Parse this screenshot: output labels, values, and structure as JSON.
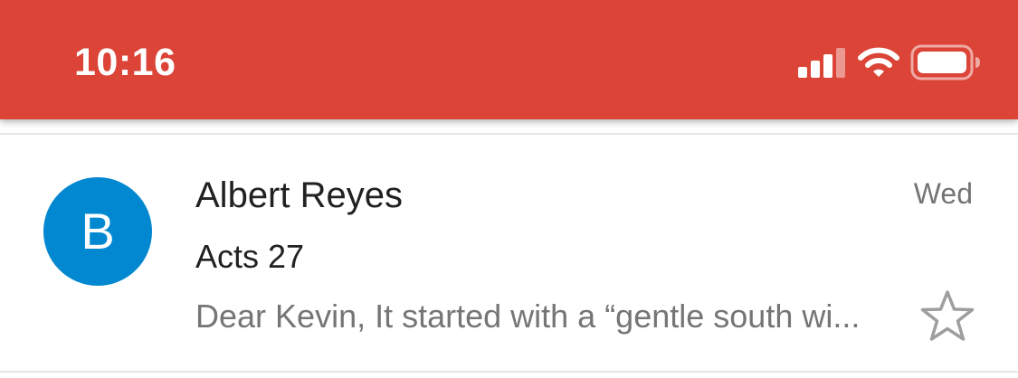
{
  "status_bar": {
    "time": "10:16",
    "color": "#db4437",
    "icons": [
      "signal-icon",
      "wifi-icon",
      "battery-icon"
    ]
  },
  "email": {
    "avatar_letter": "B",
    "avatar_color": "#0288d1",
    "sender": "Albert Reyes",
    "date": "Wed",
    "subject": "Acts 27",
    "snippet": "Dear Kevin, It started with a “gentle south wi...",
    "star_icon": "star-outline-icon"
  }
}
